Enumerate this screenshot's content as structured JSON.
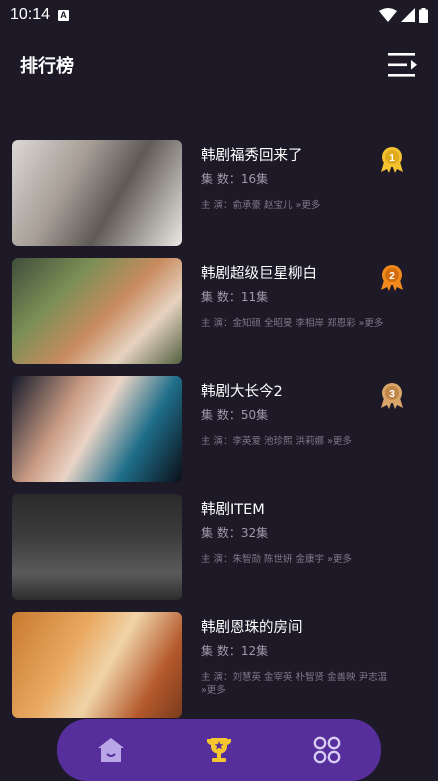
{
  "status": {
    "time": "10:14",
    "sim_letter": "A"
  },
  "header": {
    "title": "排行榜"
  },
  "rankings": [
    {
      "title": "韩剧福秀回来了",
      "episodes": "集 数：16集",
      "cast": "主 演：俞承豪 赵宝儿 »更多",
      "medal": "1",
      "medal_color": "#f2c230"
    },
    {
      "title": "韩剧超级巨星柳白",
      "episodes": "集 数：11集",
      "cast": "主 演：金知硕 全昭旻 李相岸 郑恩彩 »更多",
      "medal": "2",
      "medal_color": "#f08a1c"
    },
    {
      "title": "韩剧大长今2",
      "episodes": "集 数：50集",
      "cast": "主 演：李英爱 池珍熙 洪莉娜 »更多",
      "medal": "3",
      "medal_color": "#d9a56b"
    },
    {
      "title": "韩剧ITEM",
      "episodes": "集 数：32集",
      "cast": "主 演：朱智勋 陈世妍 金康宇 »更多"
    },
    {
      "title": "韩剧恩珠的房间",
      "episodes": "集 数：12集",
      "cast": "主 演：刘慧英 金宰英 朴智贤 金善映 尹志温 »更多"
    }
  ],
  "nav": {
    "items": [
      "home-icon",
      "trophy-icon",
      "apps-grid-icon"
    ],
    "active": "trophy-icon"
  }
}
